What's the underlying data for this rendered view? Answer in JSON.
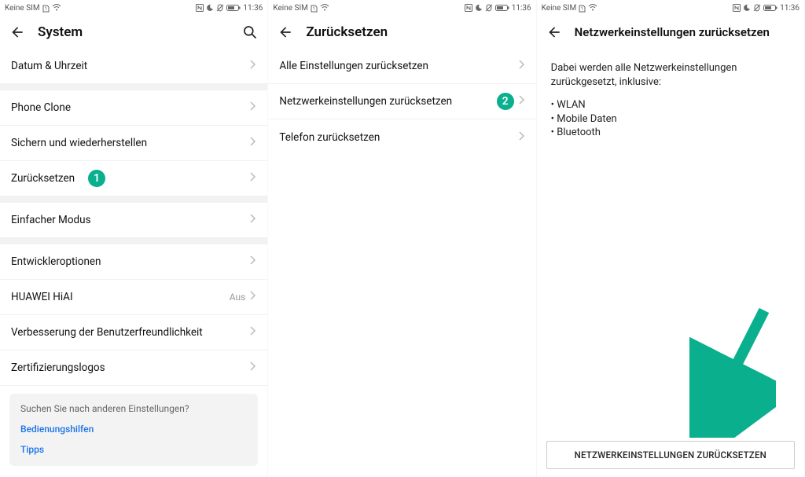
{
  "status": {
    "left_text": "Keine SIM",
    "time": "11:36"
  },
  "screen1": {
    "title": "System",
    "rows_a": [
      {
        "label": "Datum & Uhrzeit"
      }
    ],
    "rows_b": [
      {
        "label": "Phone Clone"
      },
      {
        "label": "Sichern und wiederherstellen"
      },
      {
        "label": "Zurücksetzen"
      }
    ],
    "rows_c": [
      {
        "label": "Einfacher Modus"
      }
    ],
    "rows_d": [
      {
        "label": "Entwickleroptionen"
      },
      {
        "label": "HUAWEI HiAI",
        "value": "Aus"
      },
      {
        "label": "Verbesserung der Benutzerfreundlichkeit"
      },
      {
        "label": "Zertifizierungslogos"
      }
    ],
    "suggest": {
      "prompt": "Suchen Sie nach anderen Einstellungen?",
      "link1": "Bedienungshilfen",
      "link2": "Tipps"
    },
    "badge1": "1"
  },
  "screen2": {
    "title": "Zurücksetzen",
    "rows": [
      {
        "label": "Alle Einstellungen zurücksetzen"
      },
      {
        "label": "Netzwerkeinstellungen zurücksetzen"
      },
      {
        "label": "Telefon zurücksetzen"
      }
    ],
    "badge2": "2"
  },
  "screen3": {
    "title": "Netzwerkeinstellungen zurücksetzen",
    "desc": "Dabei werden alle Netzwerkeinstellungen zurückgesetzt, inklusive:",
    "bullets": [
      "WLAN",
      "Mobile Daten",
      "Bluetooth"
    ],
    "button": "NETZWERKEINSTELLUNGEN ZURÜCKSETZEN"
  }
}
